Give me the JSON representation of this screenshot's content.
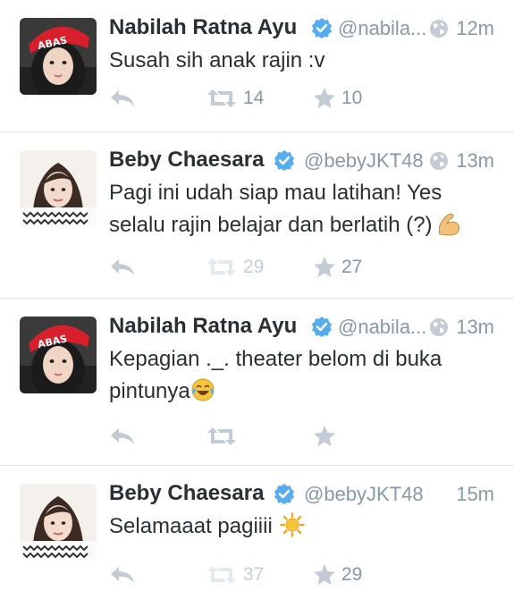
{
  "colors": {
    "verified_badge": "#55acee",
    "action_icon": "#c3ccd4",
    "name_text": "#292f33",
    "meta_text": "#8899a6",
    "divider": "#e1e8ed"
  },
  "icons": {
    "reply": "reply-arrow-icon",
    "retweet": "retweet-icon",
    "favorite": "star-icon",
    "verified": "verified-badge-icon",
    "globe": "globe-icon"
  },
  "tweets": [
    {
      "name": "Nabilah Ratna Ayu",
      "handle": "@nabila...",
      "time": "12m",
      "lines": [
        "Susah sih anak rajin :v"
      ],
      "retweets": "14",
      "favorites": "10"
    },
    {
      "name": "Beby Chaesara",
      "handle": "@bebyJKT48",
      "time": "13m",
      "lines": [
        "Pagi ini udah siap mau latihan! Yes",
        "selalu rajin belajar dan berlatih (?)"
      ],
      "emoji": "flexed-biceps-emoji",
      "retweets": "29",
      "favorites": "27"
    },
    {
      "name": "Nabilah Ratna Ayu",
      "handle": "@nabila...",
      "time": "13m",
      "lines": [
        "Kepagian ._. theater belom di buka",
        "pintunya"
      ],
      "emoji": "tears-of-joy-emoji",
      "retweets": "",
      "favorites": ""
    },
    {
      "name": "Beby Chaesara",
      "handle": "@bebyJKT48",
      "time": "15m",
      "lines": [
        "Selamaaat pagiiii"
      ],
      "emoji": "sun-emoji",
      "retweets": "37",
      "favorites": "29"
    }
  ]
}
